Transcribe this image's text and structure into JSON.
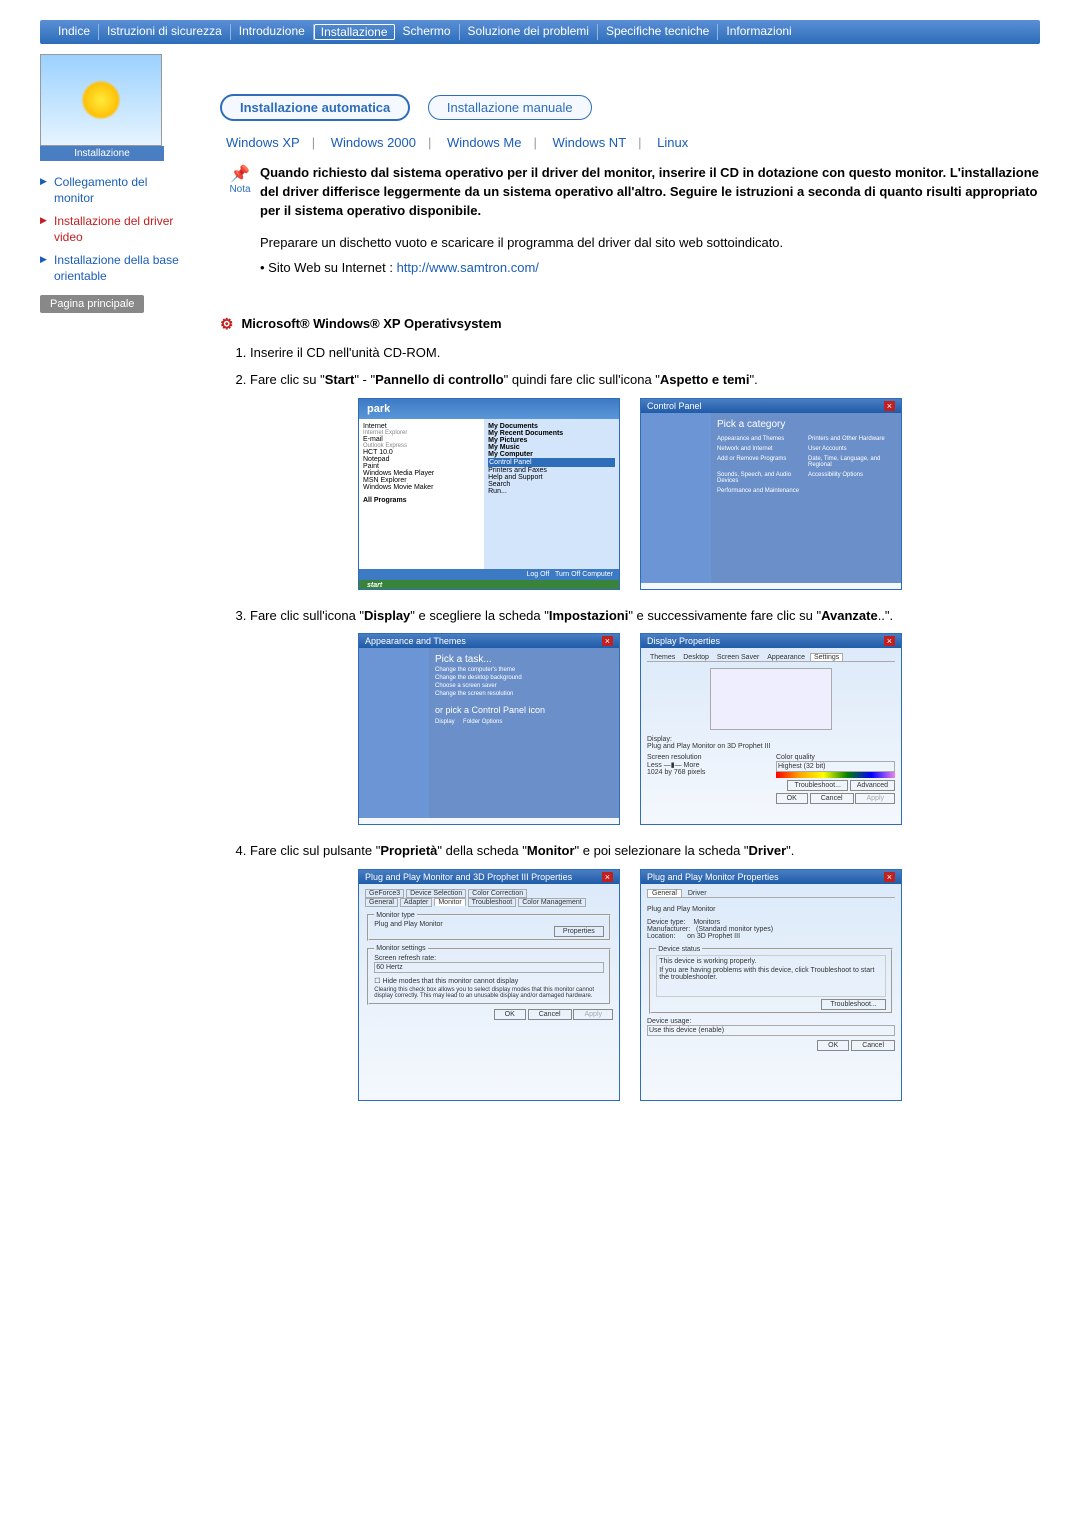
{
  "topnav": {
    "items": [
      {
        "label": "Indice",
        "active": false
      },
      {
        "label": "Istruzioni di sicurezza",
        "active": false
      },
      {
        "label": "Introduzione",
        "active": false
      },
      {
        "label": "Installazione",
        "active": true
      },
      {
        "label": "Schermo",
        "active": false
      },
      {
        "label": "Soluzione dei problemi",
        "active": false
      },
      {
        "label": "Specifiche tecniche",
        "active": false
      },
      {
        "label": "Informazioni",
        "active": false
      }
    ]
  },
  "sidebar": {
    "image_label": "Installazione",
    "items": [
      {
        "label": "Collegamento del monitor",
        "style": "blue"
      },
      {
        "label": "Installazione del driver video",
        "style": "red"
      },
      {
        "label": "Installazione della base orientable",
        "style": "blue"
      }
    ],
    "main_page": "Pagina principale"
  },
  "pills": {
    "auto": "Installazione automatica",
    "manual": "Installazione manuale"
  },
  "os_links": [
    "Windows XP",
    "Windows 2000",
    "Windows Me",
    "Windows NT",
    "Linux"
  ],
  "nota": {
    "label": "Nota",
    "text": "Quando richiesto dal sistema operativo per il driver del monitor, inserire il CD in dotazione con questo monitor. L'installazione del driver differisce leggermente da un sistema operativo all'altro. Seguire le istruzioni a seconda di quanto risulti appropriato per il sistema operativo disponibile."
  },
  "prep": "Preparare un dischetto vuoto e scaricare il programma del driver dal sito web sottoindicato.",
  "web_label": "Sito Web su Internet :",
  "web_url": "http://www.samtron.com/",
  "section_title": "Microsoft® Windows® XP Operativsystem",
  "steps": {
    "s1": "Inserire il CD nell'unità CD-ROM.",
    "s2_a": "Fare clic su \"",
    "s2_b": "Start",
    "s2_c": "\" - \"",
    "s2_d": "Pannello di controllo",
    "s2_e": "\" quindi fare clic sull'icona \"",
    "s2_f": "Aspetto e temi",
    "s2_g": "\".",
    "s3_a": "Fare clic sull'icona \"",
    "s3_b": "Display",
    "s3_c": "\" e scegliere la scheda \"",
    "s3_d": "Impostazioni",
    "s3_e": "\" e successivamente fare clic su \"",
    "s3_f": "Avanzate",
    "s3_g": "..\".",
    "s4_a": "Fare clic sul pulsante \"",
    "s4_b": "Proprietà",
    "s4_c": "\" della scheda \"",
    "s4_d": "Monitor",
    "s4_e": "\" e poi selezionare la scheda \"",
    "s4_f": "Driver",
    "s4_g": "\"."
  },
  "startmenu": {
    "user": "park",
    "left": [
      "Internet",
      "E-mail",
      "HCT 10.0",
      "Notepad",
      "Paint",
      "Windows Media Player",
      "MSN Explorer",
      "Windows Movie Maker"
    ],
    "all": "All Programs",
    "right": [
      "My Documents",
      "My Recent Documents",
      "My Pictures",
      "My Music",
      "My Computer",
      "Control Panel",
      "Printers and Faxes",
      "Help and Support",
      "Search",
      "Run..."
    ],
    "logoff": "Log Off",
    "turnoff": "Turn Off Computer",
    "start": "start"
  },
  "ctrl1": {
    "title": "Control Panel",
    "cat": "Pick a category",
    "items": [
      "Appearance and Themes",
      "Printers and Other Hardware",
      "Network and Internet",
      "User Accounts",
      "Add or Remove Programs",
      "Date, Time, Language, and Regional",
      "Sounds, Speech, and Audio Devices",
      "Accessibility Options",
      "Performance and Maintenance"
    ]
  },
  "ctrl2": {
    "title": "Appearance and Themes",
    "task": "Pick a task...",
    "t1": "Change the computer's theme",
    "t2": "Change the desktop background",
    "t3": "Choose a screen saver",
    "t4": "Change the screen resolution",
    "or": "or pick a Control Panel icon",
    "i1": "Display",
    "i2": "Folder Options"
  },
  "dispprops": {
    "title": "Display Properties",
    "tabs": [
      "Themes",
      "Desktop",
      "Screen Saver",
      "Appearance",
      "Settings"
    ],
    "display_lbl": "Display:",
    "display_val": "Plug and Play Monitor on 3D Prophet III",
    "res_lbl": "Screen resolution",
    "res_less": "Less",
    "res_more": "More",
    "res_val": "1024 by 768 pixels",
    "cq_lbl": "Color quality",
    "cq_val": "Highest (32 bit)",
    "trouble": "Troubleshoot...",
    "adv": "Advanced",
    "ok": "OK",
    "cancel": "Cancel",
    "apply": "Apply"
  },
  "monprops": {
    "title": "Plug and Play Monitor and 3D Prophet III Properties",
    "tabs1": [
      "GeForce3",
      "Device Selection",
      "Color Correction"
    ],
    "tabs2": [
      "General",
      "Adapter",
      "Monitor",
      "Troubleshoot",
      "Color Management"
    ],
    "mt": "Monitor type",
    "mt_val": "Plug and Play Monitor",
    "propbtn": "Properties",
    "ms": "Monitor settings",
    "srr": "Screen refresh rate:",
    "srr_val": "60 Hertz",
    "hide": "Hide modes that this monitor cannot display",
    "hide_desc": "Clearing this check box allows you to select display modes that this monitor cannot display correctly. This may lead to an unusable display and/or damaged hardware.",
    "ok": "OK",
    "cancel": "Cancel",
    "apply": "Apply"
  },
  "drvprops": {
    "title": "Plug and Play Monitor Properties",
    "tabs": [
      "General",
      "Driver"
    ],
    "name": "Plug and Play Monitor",
    "dt": "Device type:",
    "dt_v": "Monitors",
    "mf": "Manufacturer:",
    "mf_v": "(Standard monitor types)",
    "loc": "Location:",
    "loc_v": "on 3D Prophet III",
    "ds": "Device status",
    "ds_v": "This device is working properly.",
    "ds_h": "If you are having problems with this device, click Troubleshoot to start the troubleshooter.",
    "tbtn": "Troubleshoot...",
    "du": "Device usage:",
    "du_v": "Use this device (enable)",
    "ok": "OK",
    "cancel": "Cancel"
  }
}
